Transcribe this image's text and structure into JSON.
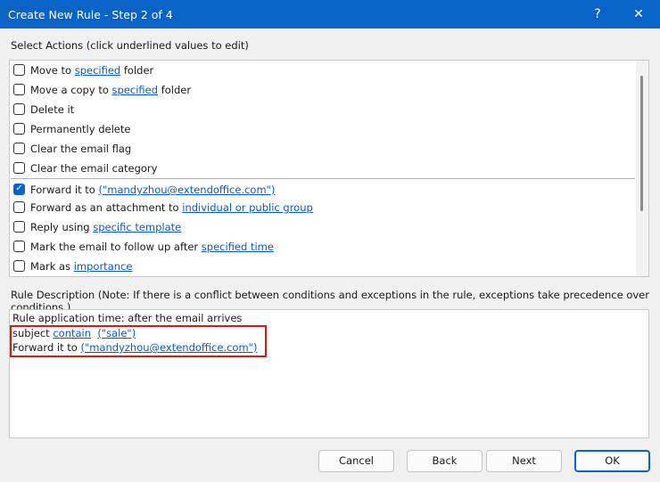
{
  "window": {
    "title": "Create New Rule - Step 2 of 4",
    "help_label": "?",
    "close_label": "✕"
  },
  "actions": {
    "label": "Select Actions (click underlined values to edit)",
    "items": [
      {
        "pre": "Move to ",
        "link": "specified",
        "post": " folder",
        "checked": false
      },
      {
        "pre": "Move a copy to ",
        "link": "specified",
        "post": " folder",
        "checked": false
      },
      {
        "pre": "Delete it",
        "link": "",
        "post": "",
        "checked": false
      },
      {
        "pre": "Permanently delete",
        "link": "",
        "post": "",
        "checked": false
      },
      {
        "pre": "Clear the email flag",
        "link": "",
        "post": "",
        "checked": false
      },
      {
        "pre": "Clear the email category",
        "link": "",
        "post": "",
        "checked": false
      },
      {
        "pre": "Forward it to ",
        "link": "(\"mandyzhou@extendoffice.com\")",
        "post": "",
        "checked": true
      },
      {
        "pre": "Forward as an attachment to ",
        "link": "individual or public group",
        "post": "",
        "checked": false
      },
      {
        "pre": "Reply using ",
        "link": "specific template",
        "post": "",
        "checked": false
      },
      {
        "pre": "Mark the email to follow up after ",
        "link": "specified time",
        "post": "",
        "checked": false
      },
      {
        "pre": "Mark as ",
        "link": "importance",
        "post": "",
        "checked": false
      }
    ]
  },
  "description": {
    "label": "Rule Description (Note: If there is a conflict between conditions and exceptions in the rule, exceptions take precedence over conditions.)",
    "line1": "Rule application time: after the email arrives",
    "line2_pre": "subject ",
    "line2_link1": "contain",
    "line2_link2": "(\"sale\")",
    "line3_pre": "Forward it to ",
    "line3_link": "(\"mandyzhou@extendoffice.com\")"
  },
  "buttons": {
    "cancel": "Cancel",
    "back": "Back",
    "next": "Next",
    "ok": "OK"
  },
  "colors": {
    "accent": "#0a64c8",
    "highlight_box": "#d11b1b",
    "link": "#0a58ca"
  }
}
